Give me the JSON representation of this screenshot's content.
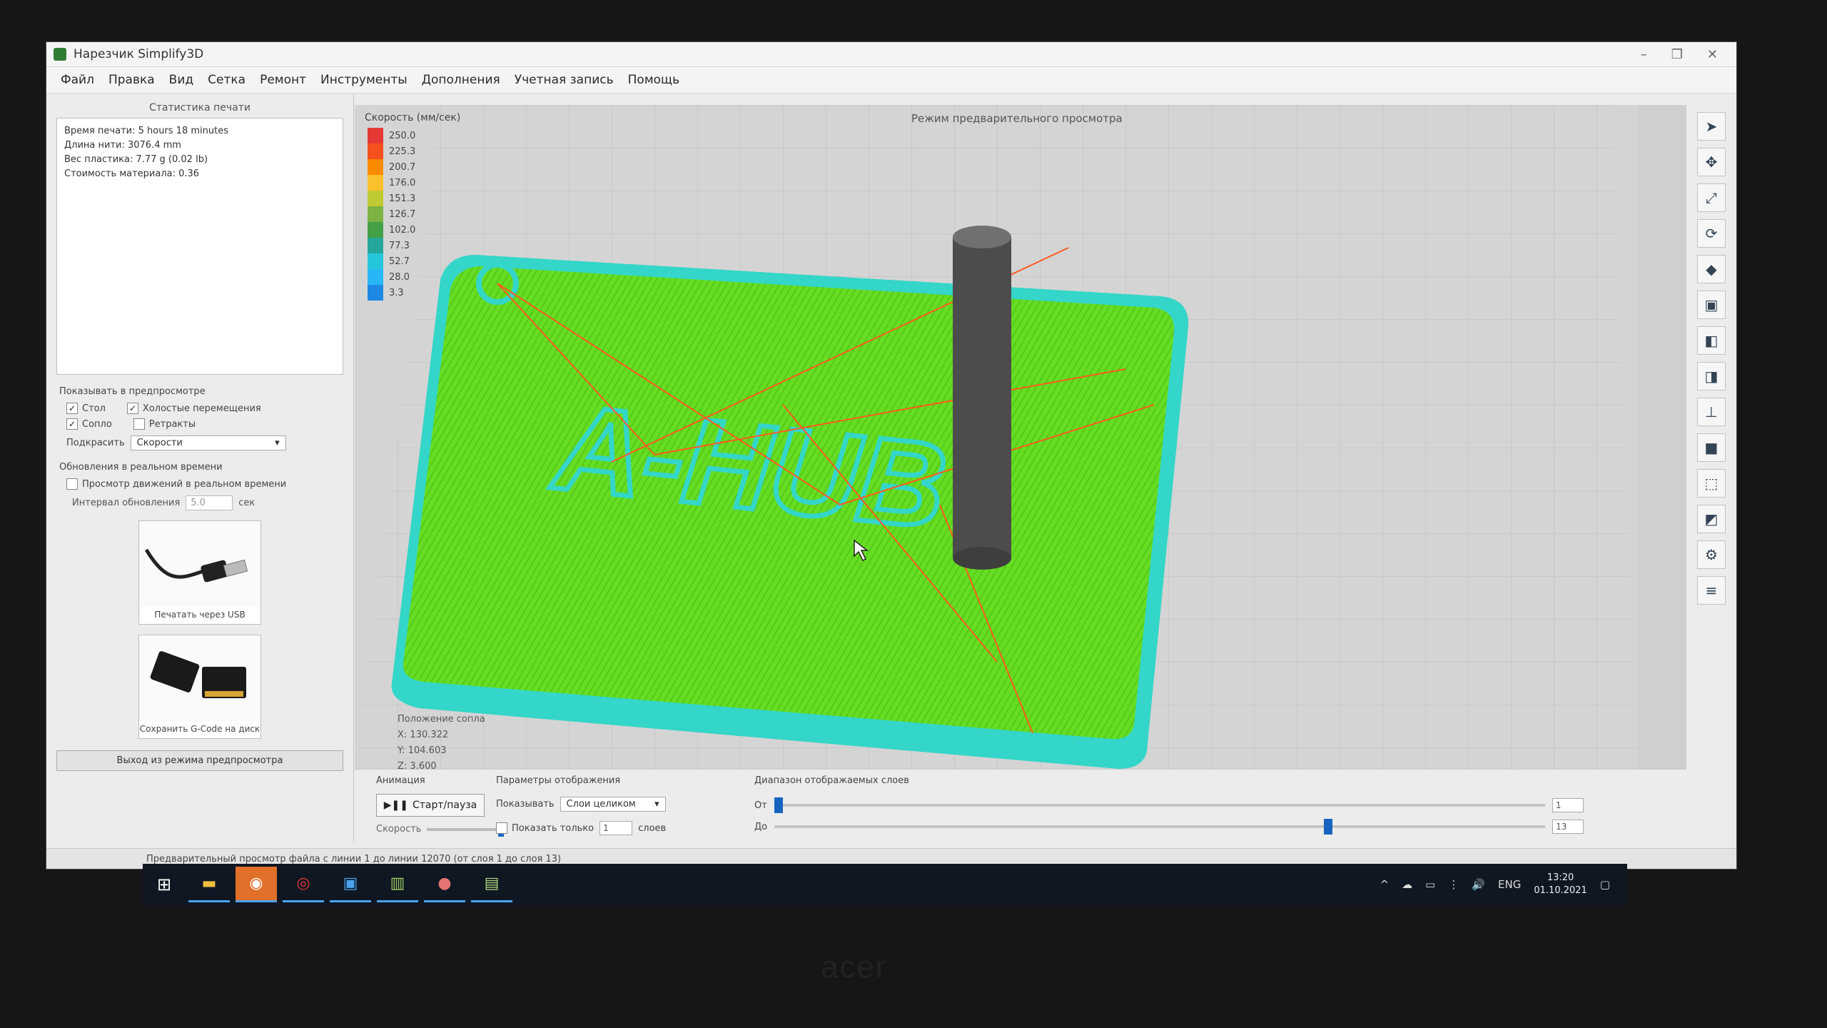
{
  "window": {
    "title": "Нарезчик Simplify3D"
  },
  "window_controls": [
    "–",
    "❐",
    "✕"
  ],
  "menu": [
    "Файл",
    "Правка",
    "Вид",
    "Сетка",
    "Ремонт",
    "Инструменты",
    "Дополнения",
    "Учетная запись",
    "Помощь"
  ],
  "stats": {
    "title": "Статистика печати",
    "lines": [
      "Время печати: 5 hours 18 minutes",
      "Длина нити: 3076.4 mm",
      "Вес пластика: 7.77 g (0.02 lb)",
      "Стоимость материала: 0.36"
    ]
  },
  "preview_options": {
    "title": "Показывать в предпросмотре",
    "checks": [
      {
        "label": "Стол",
        "checked": true
      },
      {
        "label": "Холостые перемещения",
        "checked": true
      },
      {
        "label": "Сопло",
        "checked": true
      },
      {
        "label": "Ретракты",
        "checked": false
      }
    ],
    "color_label": "Подкрасить",
    "color_value": "Скорости"
  },
  "realtime": {
    "title": "Обновления в реальном времени",
    "check_label": "Просмотр движений в реальном времени",
    "interval_label": "Интервал обновления",
    "interval_value": "5.0",
    "interval_unit": "сек"
  },
  "cards": {
    "usb_label": "Печатать через USB",
    "sd_label": "Сохранить G-Code на диск"
  },
  "exit_button": "Выход из режима предпросмотра",
  "legend": {
    "title": "Скорость (мм/сек)",
    "values": [
      "250.0",
      "225.3",
      "200.7",
      "176.0",
      "151.3",
      "126.7",
      "102.0",
      "77.3",
      "52.7",
      "28.0",
      "3.3"
    ],
    "colors": [
      "#e53935",
      "#f4511e",
      "#fb8c00",
      "#fbc02d",
      "#c0ca33",
      "#7cb342",
      "#43a047",
      "#26a69a",
      "#26c6da",
      "#29b6f6",
      "#1e88e5"
    ]
  },
  "view_mode": "Режим предварительного просмотра",
  "model": {
    "text": "A-HUB"
  },
  "nozzle": {
    "title": "Положение сопла",
    "x": "X: 130.322",
    "y": "Y: 104.603",
    "z": "Z: 3.600"
  },
  "animation": {
    "title": "Анимация",
    "play_label": "Старт/пауза",
    "speed_label": "Скорость"
  },
  "display": {
    "title": "Параметры отображения",
    "show_label": "Показывать",
    "show_value": "Слои целиком",
    "only_label": "Показать только",
    "only_value": "1",
    "only_unit": "слоев"
  },
  "layers": {
    "title": "Диапазон отображаемых слоев",
    "from_label": "От",
    "to_label": "До",
    "from_value": "1",
    "to_value": "13"
  },
  "status": "Предварительный просмотр файла с линии 1 до линии 12070 (от слоя 1 до слоя 13)",
  "taskbar": {
    "start_icon": "windows-logo",
    "apps": [
      "folder",
      "app",
      "chrome",
      "app",
      "app",
      "app",
      "app"
    ],
    "lang": "ENG",
    "time": "13:20",
    "date": "01.10.2021"
  },
  "brand": "acer"
}
